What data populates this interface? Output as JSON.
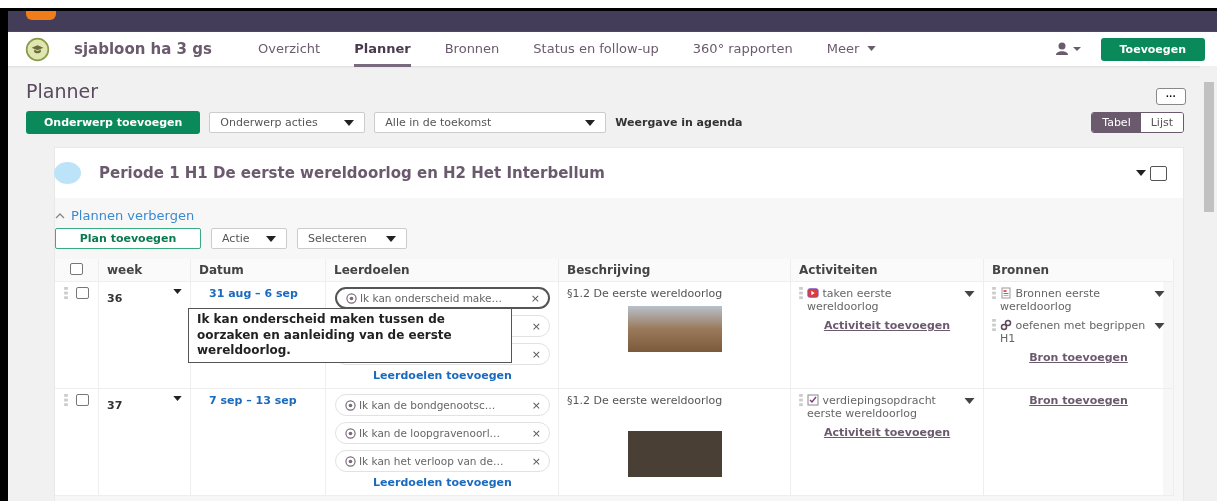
{
  "course": {
    "name": "sjabloon ha 3 gs"
  },
  "nav": [
    {
      "label": "Overzicht",
      "selected": false,
      "dropdown": false
    },
    {
      "label": "Planner",
      "selected": true,
      "dropdown": false
    },
    {
      "label": "Bronnen",
      "selected": false,
      "dropdown": false
    },
    {
      "label": "Status en follow-up",
      "selected": false,
      "dropdown": false
    },
    {
      "label": "360° rapporten",
      "selected": false,
      "dropdown": false
    },
    {
      "label": "Meer",
      "selected": false,
      "dropdown": true
    }
  ],
  "add_button": "Toevoegen",
  "page_title": "Planner",
  "more_button": "···",
  "toolbar": {
    "add_topic": "Onderwerp toevoegen",
    "topic_actions": "Onderwerp acties",
    "filter": "Alle in de toekomst",
    "agenda_link": "Weergave in agenda"
  },
  "view_toggle": [
    {
      "label": "Tabel",
      "selected": true
    },
    {
      "label": "Lijst",
      "selected": false
    }
  ],
  "topic": {
    "checked": false,
    "title": "Periode 1 H1 De eerste wereldoorlog en H2 Het Interbellum",
    "hide_plans": "Plannen verbergen",
    "plan_add": "Plan toevoegen",
    "action": "Actie",
    "select": "Selecteren"
  },
  "table": {
    "all_checked": false,
    "columns": [
      "week",
      "Datum",
      "Leerdoelen",
      "Beschrijving",
      "Activiteiten",
      "Bronnen"
    ],
    "rows": [
      {
        "checked": false,
        "week": "36",
        "date": "31 aug – 6 sep",
        "goals": [
          {
            "kind": "chip",
            "label": "Ik kan onderscheid make…",
            "remove": "×",
            "focused": true
          },
          {
            "kind": "covered",
            "remove": "×",
            "focused": false
          },
          {
            "kind": "covered",
            "remove": "×",
            "focused": false
          }
        ],
        "goal_add": "Leerdoelen toevoegen",
        "description": "§1.2 De eerste wereldoorlog",
        "activities": [
          {
            "kind": "video",
            "label": "taken eerste wereldoorlog"
          }
        ],
        "activity_add": "Activiteit toevoegen",
        "sources": [
          {
            "kind": "document",
            "label": "Bronnen eerste wereldoorlog"
          },
          {
            "kind": "link",
            "label": "oefenen met begrippen H1"
          }
        ],
        "source_add": "Bron toevoegen",
        "tooltip": "Ik kan onderscheid maken tussen de oorzaken en aanleiding van de eerste wereldoorlog."
      },
      {
        "checked": false,
        "week": "37",
        "date": "7 sep – 13 sep",
        "goals": [
          {
            "kind": "chip",
            "label": "Ik kan de bondgenootsc…",
            "remove": "×",
            "focused": false
          },
          {
            "kind": "chip",
            "label": "Ik kan de loopgravenoorl…",
            "remove": "×",
            "focused": false
          },
          {
            "kind": "chip",
            "label": "Ik kan het verloop van de…",
            "remove": "×",
            "focused": false
          }
        ],
        "goal_add": "Leerdoelen toevoegen",
        "description": "§1.2 De eerste wereldoorlog",
        "activities": [
          {
            "kind": "assignment",
            "label": "verdiepingsopdracht eerste wereldoorlog"
          }
        ],
        "activity_add": "Activiteit toevoegen",
        "sources": [],
        "source_add": "Bron toevoegen"
      }
    ]
  }
}
